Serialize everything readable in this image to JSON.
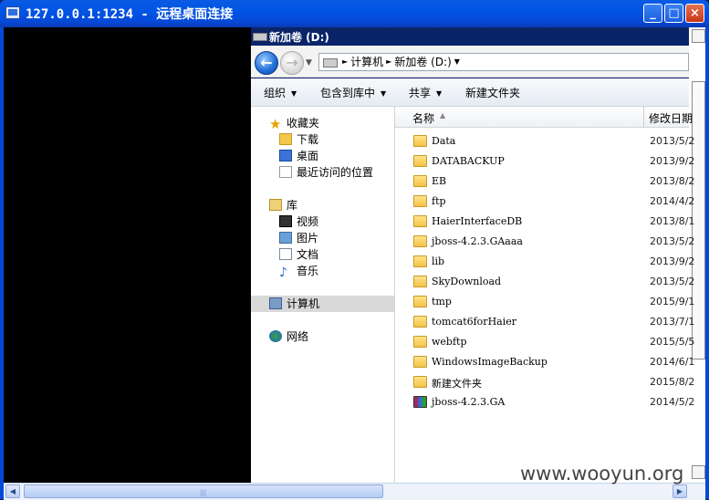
{
  "window": {
    "title": "127.0.0.1:1234 - 远程桌面连接",
    "min_label": "_",
    "max_label": "□",
    "close_label": "×"
  },
  "explorer": {
    "title": "新加卷 (D:)",
    "breadcrumb": [
      "计算机",
      "新加卷 (D:)"
    ],
    "toolbar": [
      {
        "label": "组织",
        "dropdown": true
      },
      {
        "label": "包含到库中",
        "dropdown": true
      },
      {
        "label": "共享",
        "dropdown": true
      },
      {
        "label": "新建文件夹",
        "dropdown": false
      }
    ],
    "nav": {
      "favorites": {
        "label": "收藏夹",
        "items": [
          "下载",
          "桌面",
          "最近访问的位置"
        ]
      },
      "libraries": {
        "label": "库",
        "items": [
          "视频",
          "图片",
          "文档",
          "音乐"
        ]
      },
      "computer": "计算机",
      "network": "网络"
    },
    "columns": {
      "name": "名称",
      "date": "修改日期"
    },
    "files": [
      {
        "name": "Data",
        "date": "2013/5/2",
        "type": "folder"
      },
      {
        "name": "DATABACKUP",
        "date": "2013/9/2",
        "type": "folder"
      },
      {
        "name": "EB",
        "date": "2013/8/2",
        "type": "folder"
      },
      {
        "name": "ftp",
        "date": "2014/4/2",
        "type": "folder"
      },
      {
        "name": "HaierInterfaceDB",
        "date": "2013/8/1",
        "type": "folder"
      },
      {
        "name": "jboss-4.2.3.GAaaa",
        "date": "2013/5/2",
        "type": "folder"
      },
      {
        "name": "lib",
        "date": "2013/9/2",
        "type": "folder"
      },
      {
        "name": "SkyDownload",
        "date": "2013/5/2",
        "type": "folder"
      },
      {
        "name": "tmp",
        "date": "2015/9/1",
        "type": "folder"
      },
      {
        "name": "tomcat6forHaier",
        "date": "2013/7/1",
        "type": "folder"
      },
      {
        "name": "webftp",
        "date": "2015/5/5",
        "type": "folder"
      },
      {
        "name": "WindowsImageBackup",
        "date": "2014/6/1",
        "type": "folder"
      },
      {
        "name": "新建文件夹",
        "date": "2015/8/2",
        "type": "folder"
      },
      {
        "name": "jboss-4.2.3.GA",
        "date": "2014/5/2",
        "type": "archive"
      }
    ]
  },
  "watermark": "www.wooyun.org"
}
